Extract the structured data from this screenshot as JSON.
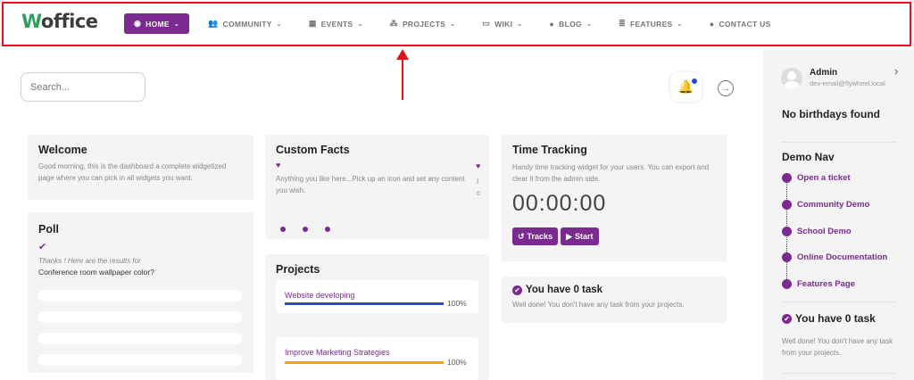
{
  "logo": {
    "first": "W",
    "rest": "office"
  },
  "nav": [
    {
      "label": "HOME",
      "icon": "dashboard-icon",
      "glyph": "◉",
      "chev": "⌄",
      "active": true
    },
    {
      "label": "COMMUNITY",
      "icon": "users-icon",
      "glyph": "👥",
      "chev": "⌄"
    },
    {
      "label": "EVENTS",
      "icon": "calendar-icon",
      "glyph": "▦",
      "chev": "⌄"
    },
    {
      "label": "PROJECTS",
      "icon": "cubes-icon",
      "glyph": "⁂",
      "chev": "⌄"
    },
    {
      "label": "WIKI",
      "icon": "book-icon",
      "glyph": "▭",
      "chev": "⌄"
    },
    {
      "label": "BLOG",
      "icon": "comments-icon",
      "glyph": "●",
      "chev": "⌄"
    },
    {
      "label": "FEATURES",
      "icon": "list-icon",
      "glyph": "≣",
      "chev": "⌄"
    },
    {
      "label": "CONTACT US",
      "icon": "comment-icon",
      "glyph": "●",
      "chev": ""
    }
  ],
  "search": {
    "placeholder": "Search..."
  },
  "welcome": {
    "title": "Welcome",
    "text": "Good morning, this is the dashboard a complete widgetized page where you can pick in all widgets you want."
  },
  "poll": {
    "title": "Poll",
    "check": "✔",
    "thanks": "Thanks ! Here are the results for",
    "question": "Conference room wallpaper color?"
  },
  "custom_facts": {
    "title": "Custom Facts",
    "heart": "♥",
    "text": "Anything you like here...Pick up an icon and set any content you wish.",
    "slide2_heart": "♥",
    "slide2_text": "I c"
  },
  "projects": {
    "title": "Projects",
    "items": [
      {
        "label": "Website developing",
        "progress": 100,
        "pct_text": "100%",
        "color": "#3346c8"
      },
      {
        "label": "Improve Marketing Strategies",
        "progress": 100,
        "pct_text": "100%",
        "color": "#f5a400"
      }
    ]
  },
  "time_tracking": {
    "title": "Time Tracking",
    "text": "Handy time tracking widget for your users. You can export and clear it from the admin side.",
    "timer": "00:00:00",
    "tracks_label": "Tracks",
    "tracks_icon": "↺",
    "start_label": "Start",
    "start_icon": "▶"
  },
  "tasks": {
    "check": "✔",
    "title": "You have 0 task",
    "text": "Well done! You don't have any task from your projects."
  },
  "sidebar": {
    "user_name": "Admin",
    "user_email": "dev-email@flywheel.local",
    "chevron": "›",
    "birthdays": "No birthdays found",
    "demo_nav_title": "Demo Nav",
    "demo_nav": [
      "Open a ticket",
      "Community Demo",
      "School Demo",
      "Online Documentation",
      "Features Page"
    ],
    "tasks_check": "✔",
    "tasks_title": "You have 0 task",
    "tasks_text": "Well done! You don't have any task from your projects."
  },
  "bell_icon": "🔔",
  "logout_icon": "→",
  "colors": {
    "accent": "#7b2a8f",
    "highlight": "#e0141b",
    "card_bg": "#f4f4f5"
  }
}
